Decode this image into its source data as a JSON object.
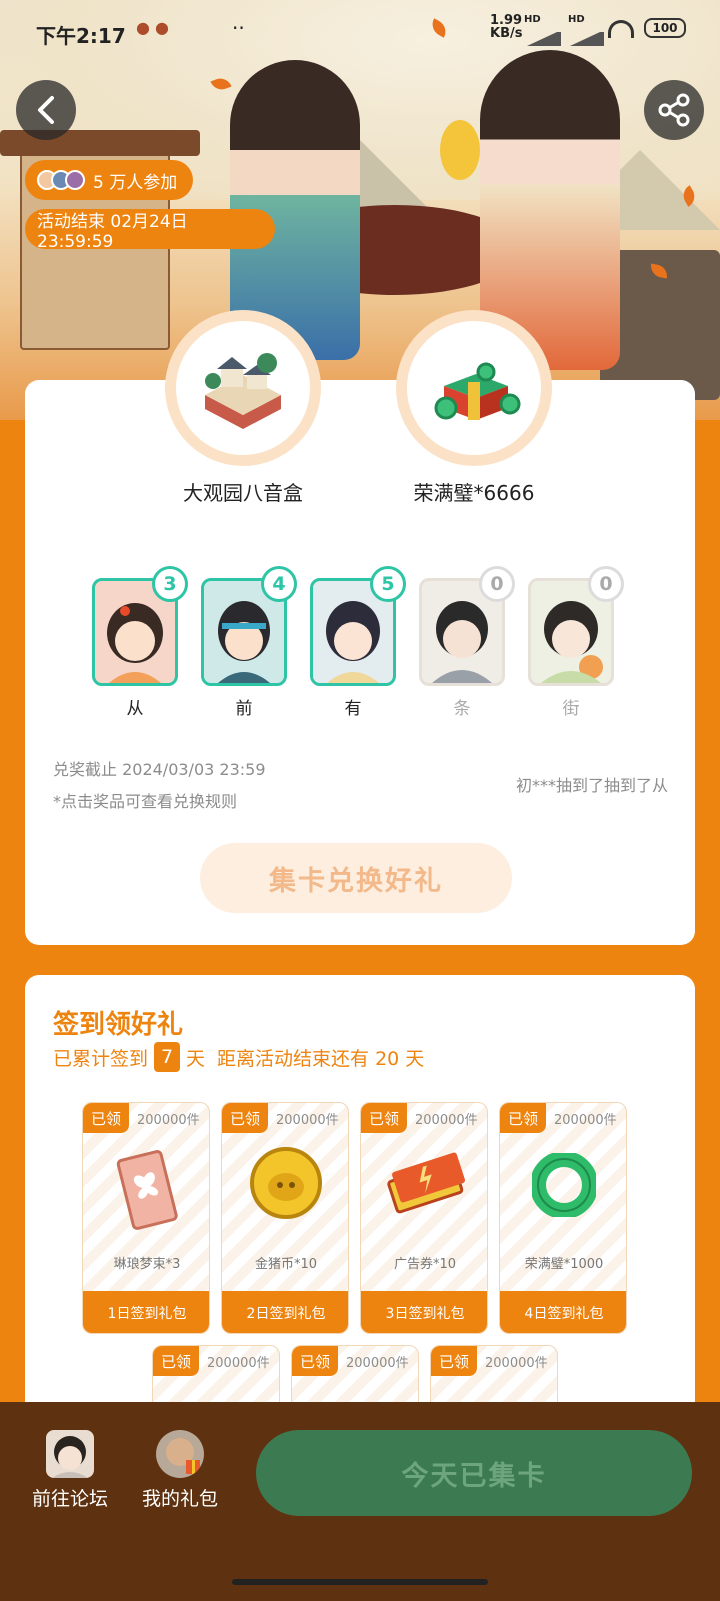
{
  "status_bar": {
    "time": "下午2:17",
    "net_speed": "1.99",
    "net_unit": "KB/s",
    "hd1": "HD",
    "hd2": "HD",
    "battery": "100"
  },
  "hero": {
    "participants": "5 万人参加",
    "end_time": "活动结束 02月24日 23:59:59"
  },
  "prizes": [
    {
      "name": "大观园八音盒",
      "icon": "music-box-garden-icon"
    },
    {
      "name": "荣满璧*6666",
      "icon": "gift-box-jade-icon"
    }
  ],
  "cards": [
    {
      "label": "从",
      "count": "3",
      "collected": true
    },
    {
      "label": "前",
      "count": "4",
      "collected": true
    },
    {
      "label": "有",
      "count": "5",
      "collected": true
    },
    {
      "label": "条",
      "count": "0",
      "collected": false
    },
    {
      "label": "街",
      "count": "0",
      "collected": false
    }
  ],
  "exchange": {
    "deadline": "兑奖截止 2024/03/03 23:59",
    "rule_note": "*点击奖品可查看兑换规则",
    "ticker": "初***抽到了抽到了从",
    "button": "集卡兑换好礼"
  },
  "signin": {
    "title": "签到领好礼",
    "prefix": "已累计签到",
    "days": "7",
    "suffix": "天",
    "remain": "距离活动结束还有 20 天",
    "gifts": [
      {
        "badge": "已领",
        "stock": "200000件",
        "name": "琳琅梦束*3",
        "footer": "1日签到礼包",
        "icon": "ticket-butterfly-icon"
      },
      {
        "badge": "已领",
        "stock": "200000件",
        "name": "金猪币*10",
        "footer": "2日签到礼包",
        "icon": "gold-pig-coin-icon"
      },
      {
        "badge": "已领",
        "stock": "200000件",
        "name": "广告券*10",
        "footer": "3日签到礼包",
        "icon": "ad-ticket-icon"
      },
      {
        "badge": "已领",
        "stock": "200000件",
        "name": "荣满璧*1000",
        "footer": "4日签到礼包",
        "icon": "jade-ring-icon"
      },
      {
        "badge": "已领",
        "stock": "200000件"
      },
      {
        "badge": "已领",
        "stock": "200000件"
      },
      {
        "badge": "已领",
        "stock": "200000件"
      }
    ]
  },
  "bottom": {
    "forum": "前往论坛",
    "gifts": "我的礼包",
    "collect": "今天已集卡"
  }
}
